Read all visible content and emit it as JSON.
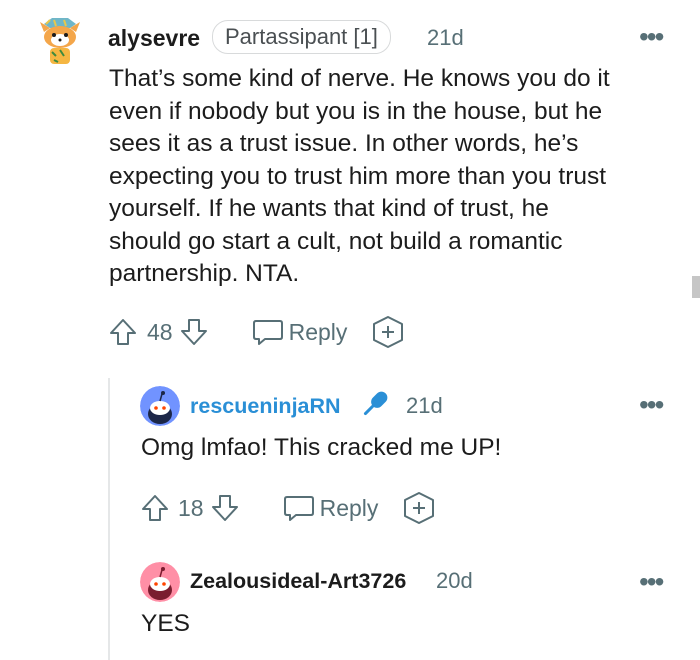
{
  "comments": [
    {
      "username": "alysevre",
      "flair": "Partassipant [1]",
      "age": "21d",
      "lines": [
        "That’s some kind of nerve. He knows you do it",
        "even if nobody but you is in the house, but he",
        "sees it as a trust issue. In other words, he’s",
        "expecting you to trust him more than you trust",
        "yourself. If he wants that kind of trust, he",
        "should go start a cult, not build a romantic",
        "partnership. NTA."
      ],
      "votes": "48",
      "reply_label": "Reply"
    },
    {
      "username": "rescueninjaRN",
      "age": "21d",
      "text": "Omg lmfao! This cracked me UP!",
      "votes": "18",
      "reply_label": "Reply",
      "username_color": "#2a8fd6",
      "badge_icon": "microphone-icon"
    },
    {
      "username": "Zealousideal-Art3726",
      "age": "20d",
      "text": "YES"
    }
  ],
  "more_icon": "•••",
  "colors": {
    "accent_blue": "#2a8fd6",
    "meta_gray": "#576f76"
  }
}
